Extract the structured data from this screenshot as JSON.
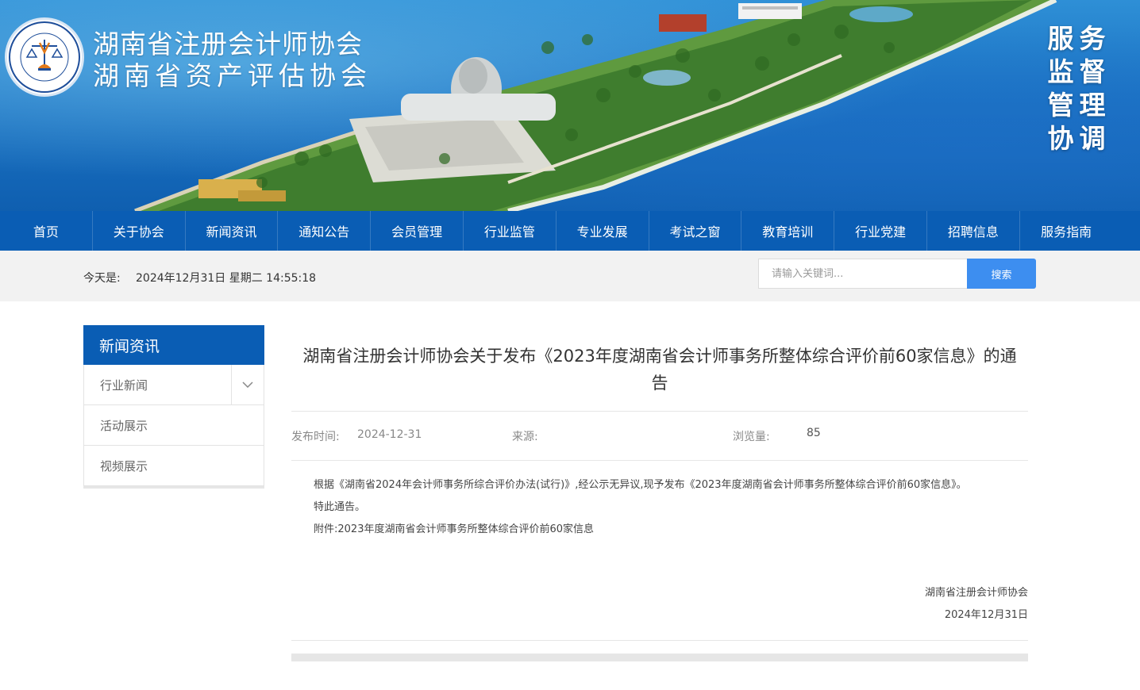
{
  "header": {
    "org_name_line1": "湖南省注册会计师协会",
    "org_name_line2": "湖南省资产评估协会",
    "logo_ring_text": "THE HUNAN INSTITUTE OF CERTIFIED PUBLIC ACCOUNTANTS",
    "logo_cn_text": "湖南省注册会计师协会",
    "motto": [
      "服",
      "务",
      "监",
      "督",
      "管",
      "理",
      "协",
      "调"
    ]
  },
  "nav": {
    "items": [
      "首页",
      "关于协会",
      "新闻资讯",
      "通知公告",
      "会员管理",
      "行业监管",
      "专业发展",
      "考试之窗",
      "教育培训",
      "行业党建",
      "招聘信息",
      "服务指南"
    ]
  },
  "infobar": {
    "date_label": "今天是:",
    "date_value": "2024年12月31日 星期二 14:55:18",
    "search_placeholder": "请输入关键词...",
    "search_button": "搜索"
  },
  "sidebar": {
    "title": "新闻资讯",
    "items": [
      "行业新闻",
      "活动展示",
      "视频展示"
    ]
  },
  "article": {
    "title": "湖南省注册会计师协会关于发布《2023年度湖南省会计师事务所整体综合评价前60家信息》的通告",
    "publish_label": "发布时间:",
    "publish_date": "2024-12-31",
    "source_label": "来源:",
    "views_label": "浏览量:",
    "views": "85",
    "paragraph1": "根据《湖南省2024年会计师事务所综合评价办法(试行)》,经公示无异议,现予发布《2023年度湖南省会计师事务所整体综合评价前60家信息》。",
    "paragraph2": "特此通告。",
    "attachment": "附件:2023年度湖南省会计师事务所整体综合评价前60家信息",
    "signature_org": "湖南省注册会计师协会",
    "signature_date": "2024年12月31日"
  },
  "colors": {
    "nav_bg": "#0a5db4",
    "search_button": "#3d8ef0",
    "infobar_bg": "#f2f2f2"
  }
}
